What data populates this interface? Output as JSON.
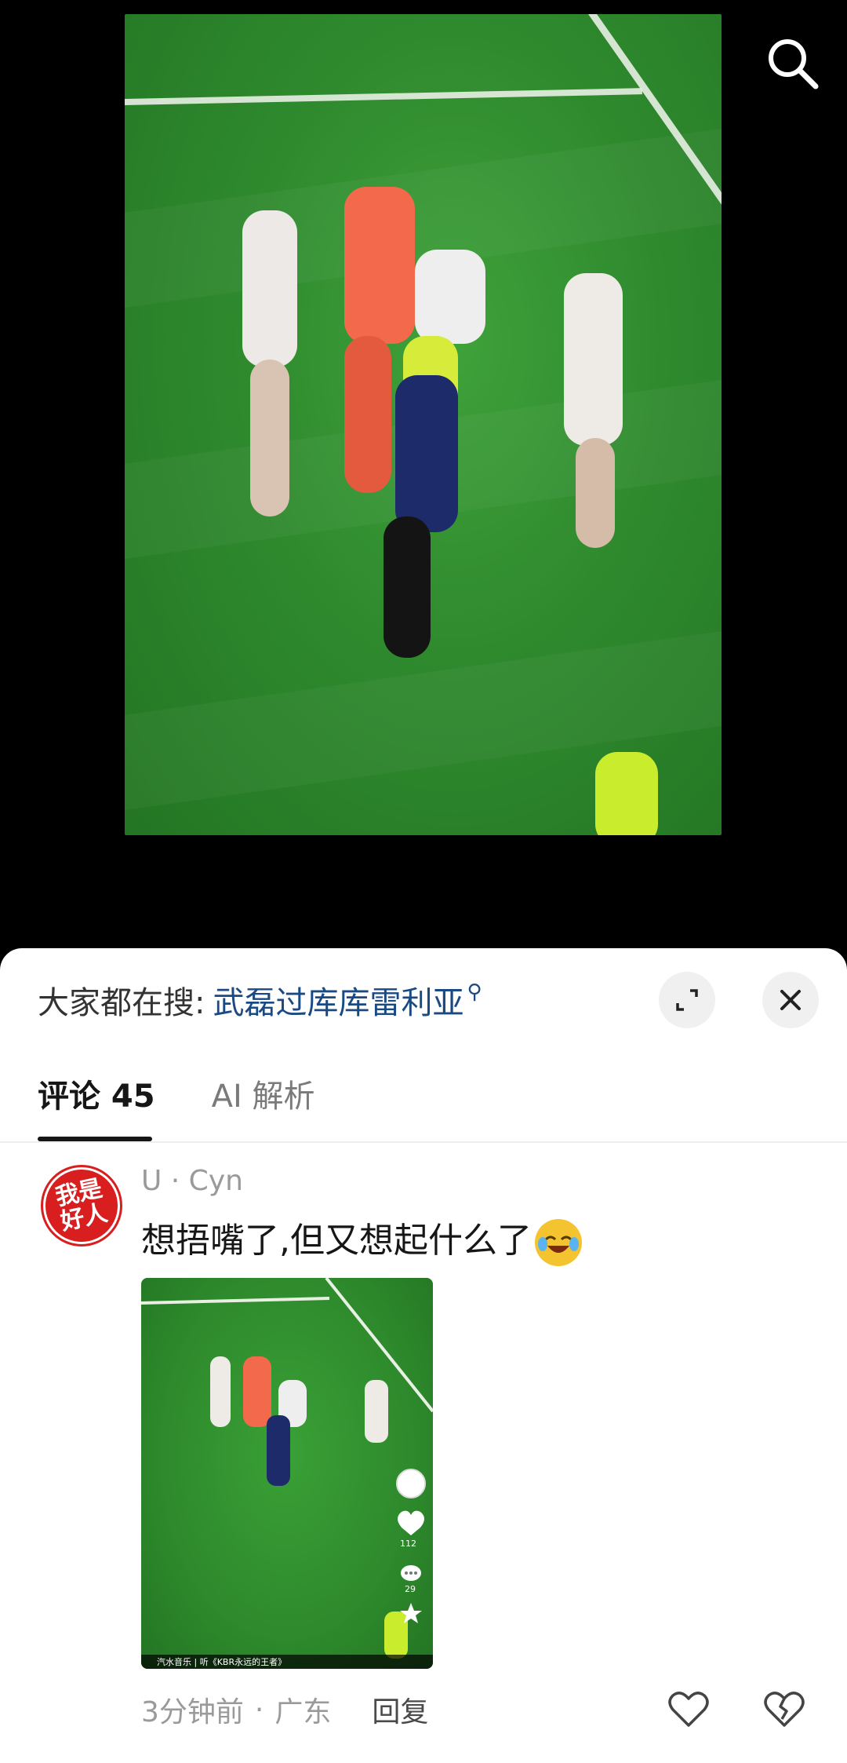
{
  "video": {
    "icons": {
      "search": "search-icon"
    }
  },
  "sheet": {
    "trending": {
      "prefix": "大家都在搜:",
      "query": "武磊过库库雷利亚"
    },
    "tabs": [
      {
        "label": "评论 45",
        "active": true
      },
      {
        "label": "AI 解析",
        "active": false
      }
    ],
    "comment": {
      "avatar_text_1": "我是",
      "avatar_text_2": "好人",
      "username": "U · Cyn",
      "text": "想捂嘴了,但又想起什么了",
      "time": "3分钟前",
      "location": "广东",
      "reply_label": "回复",
      "image": {
        "like_count": "112",
        "comment_count": "29",
        "music_label": "汽水音乐 | 听《KBR永远的王者》"
      }
    }
  },
  "colors": {
    "link": "#1a4a84",
    "pitch": "#2f8a2e"
  }
}
